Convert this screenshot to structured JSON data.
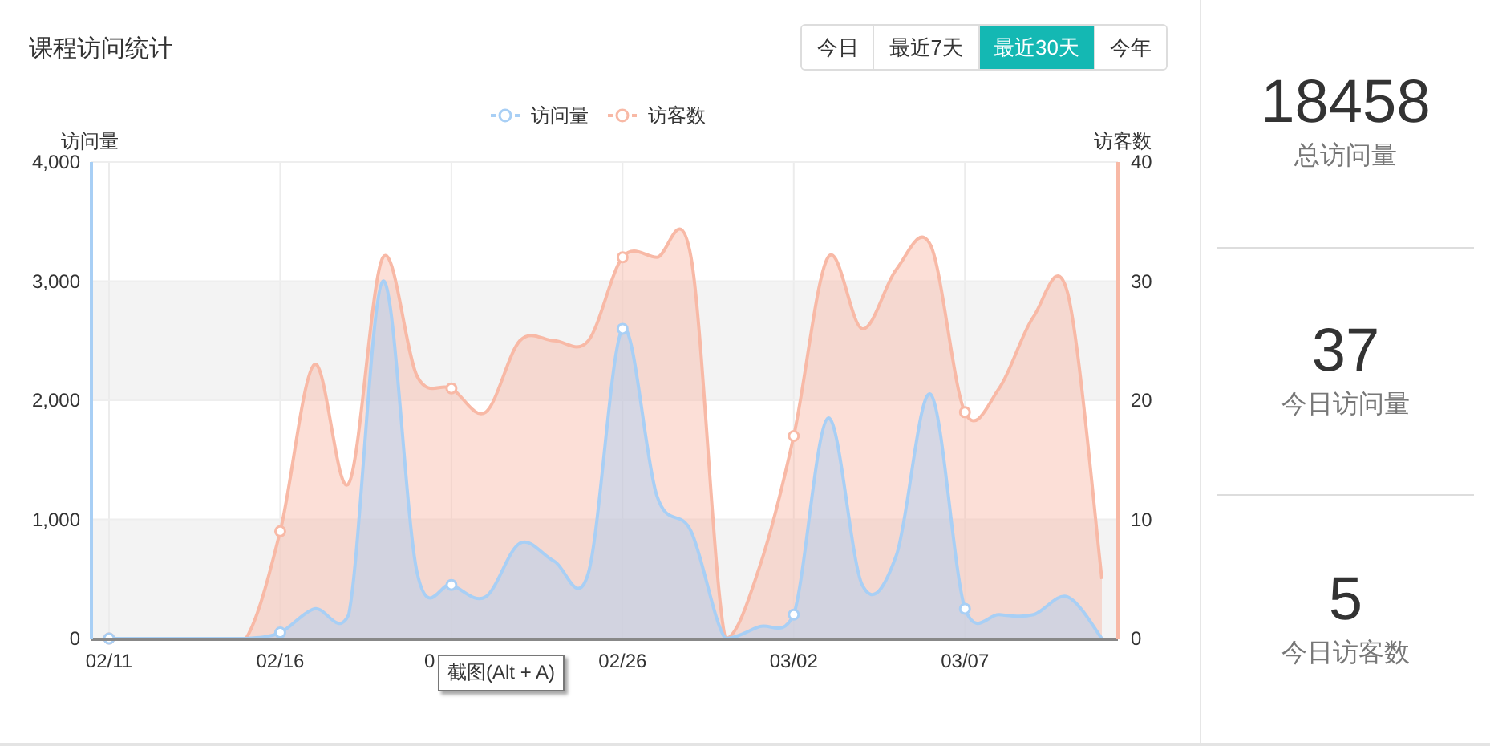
{
  "title": "课程访问统计",
  "ranges": [
    {
      "label": "今日",
      "selected": false
    },
    {
      "label": "最近7天",
      "selected": false
    },
    {
      "label": "最近30天",
      "selected": true
    },
    {
      "label": "今年",
      "selected": false
    }
  ],
  "chart": {
    "chart_data": {
      "type": "area",
      "categories": [
        "02/11",
        null,
        null,
        null,
        null,
        "02/16",
        null,
        null,
        null,
        null,
        null,
        null,
        null,
        null,
        null,
        "02/26",
        null,
        null,
        null,
        null,
        "03/02",
        null,
        null,
        null,
        null,
        "03/07",
        null,
        null,
        null,
        null
      ],
      "series": [
        {
          "name": "访问量",
          "color": "#a8cff5",
          "values": [
            0,
            0,
            0,
            0,
            0,
            50,
            250,
            200,
            3000,
            550,
            450,
            350,
            800,
            650,
            550,
            2600,
            1200,
            900,
            0,
            100,
            200,
            1850,
            450,
            700,
            2050,
            250,
            200,
            200,
            350,
            0
          ]
        },
        {
          "name": "访客数",
          "color": "#f8b9a6",
          "axis": "y2",
          "values": [
            0,
            0,
            0,
            0,
            0,
            9,
            23,
            13,
            32,
            22,
            21,
            19,
            25,
            25,
            25,
            32,
            32,
            32,
            0,
            6,
            17,
            32,
            26,
            31,
            33,
            19,
            21,
            27,
            29,
            5
          ]
        }
      ],
      "ylabel": "访问量",
      "y2label": "访客数",
      "ylim": [
        0,
        4000
      ],
      "y2lim": [
        0,
        40
      ],
      "yticks": [
        {
          "value": 0,
          "label": "0"
        },
        {
          "value": 1000,
          "label": "1,000"
        },
        {
          "value": 2000,
          "label": "2,000"
        },
        {
          "value": 3000,
          "label": "3,000"
        },
        {
          "value": 4000,
          "label": "4,000"
        }
      ],
      "y2ticks": [
        0,
        10,
        20,
        30,
        40
      ],
      "grid": true,
      "legend": true
    },
    "covered_axis_label": "0"
  },
  "tooltip": {
    "text": "截图(Alt + A)"
  },
  "stats": [
    {
      "value": "18458",
      "label": "总访问量"
    },
    {
      "value": "37",
      "label": "今日访问量"
    },
    {
      "value": "5",
      "label": "今日访客数"
    }
  ]
}
